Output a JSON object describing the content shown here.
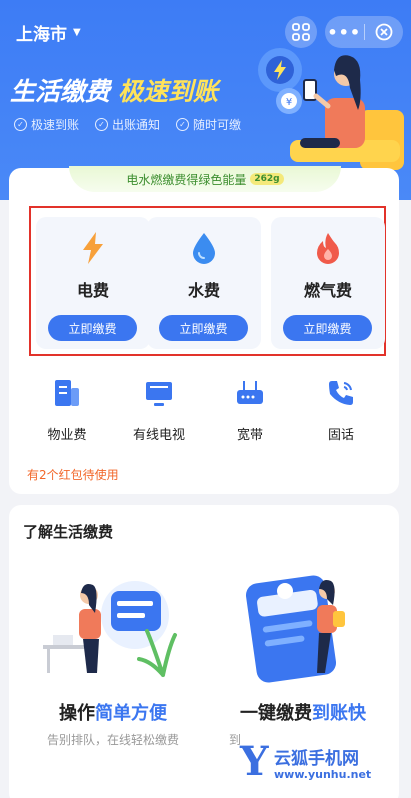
{
  "header": {
    "city": "上海市",
    "more_label": "•••"
  },
  "hero": {
    "title_main": "生活缴费",
    "title_accent": "极速到账",
    "tags": [
      "极速到账",
      "出账通知",
      "随时可缴"
    ],
    "accent_color": "#ffe35a",
    "bg_color": "#3d7cf5"
  },
  "energy": {
    "text": "电水燃缴费得绿色能量",
    "badge": "262g"
  },
  "utilities": [
    {
      "name": "电费",
      "pay_label": "立即缴费",
      "icon": "lightning-icon"
    },
    {
      "name": "水费",
      "pay_label": "立即缴费",
      "icon": "water-drop-icon"
    },
    {
      "name": "燃气费",
      "pay_label": "立即缴费",
      "icon": "flame-icon"
    }
  ],
  "services": [
    {
      "name": "物业费",
      "icon": "building-icon"
    },
    {
      "name": "有线电视",
      "icon": "tv-icon"
    },
    {
      "name": "宽带",
      "icon": "router-icon"
    },
    {
      "name": "固话",
      "icon": "phone-icon"
    }
  ],
  "redpack_text": "有2个红包待使用",
  "learn": {
    "title": "了解生活缴费",
    "features": [
      {
        "title_plain": "操作",
        "title_highlight": "简单方便",
        "desc": "告别排队，在线轻松缴费"
      },
      {
        "title_plain": "一键缴费",
        "title_highlight": "到账快",
        "desc": "到"
      }
    ]
  },
  "watermark": {
    "letter": "Y",
    "name": "云狐手机网",
    "url": "www.yunhu.net"
  }
}
